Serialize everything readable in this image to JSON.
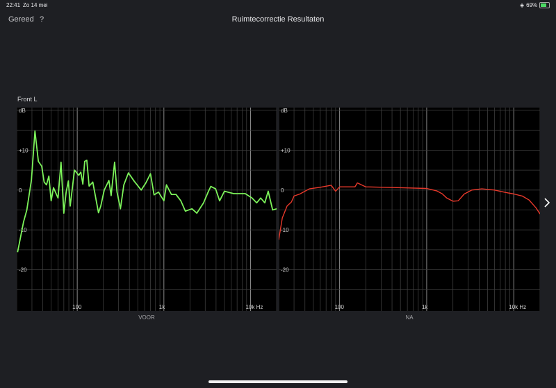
{
  "status_bar": {
    "time": "22:41",
    "date": "Zo 14 mei",
    "battery": "69%"
  },
  "nav": {
    "done_label": "Gereed",
    "help_label": "?",
    "title": "Ruimtecorrectie Resultaten"
  },
  "speaker_label": "Front L",
  "colors": {
    "before": "#7cf25a",
    "after": "#e8392b"
  },
  "chart_data": [
    {
      "type": "line",
      "title": "VOOR",
      "xlabel": "Hz",
      "ylabel": "dB",
      "xscale": "log",
      "xlim": [
        20,
        20000
      ],
      "ylim": [
        -30,
        20
      ],
      "xticks": [
        {
          "v": 100,
          "label": "100"
        },
        {
          "v": 1000,
          "label": "1k"
        },
        {
          "v": 10000,
          "label": "10k Hz"
        }
      ],
      "yticks": [
        {
          "v": 20,
          "label": "dB"
        },
        {
          "v": 10,
          "label": "+10"
        },
        {
          "v": 0,
          "label": "0"
        },
        {
          "v": -10,
          "label": "-10"
        },
        {
          "v": -20,
          "label": "-20"
        }
      ],
      "grid": true,
      "series": [
        {
          "name": "VOOR",
          "x": [
            20.5,
            24,
            26.2,
            29.6,
            32.5,
            35.6,
            38.9,
            41.5,
            44.2,
            47,
            50,
            53.2,
            60,
            65,
            70,
            74.5,
            79,
            83,
            93,
            104,
            110,
            116,
            122,
            129,
            137,
            151,
            165,
            176,
            187,
            205,
            232,
            246,
            270,
            288,
            315,
            345,
            390,
            455,
            548,
            620,
            700,
            770,
            865,
            1000,
            1070,
            1220,
            1380,
            1570,
            1770,
            2110,
            2400,
            2870,
            3270,
            3480,
            3950,
            4400,
            5000,
            6400,
            8700,
            10400,
            11800,
            13100,
            14600,
            16000,
            18000,
            20000
          ],
          "y": [
            -15.6,
            -8,
            -5,
            2.5,
            14.8,
            7.2,
            6,
            2,
            1.3,
            3.5,
            -2.7,
            0.6,
            -2,
            7,
            -5.8,
            -0.5,
            2.3,
            -4,
            5,
            3.7,
            4.5,
            1.5,
            7.2,
            7.5,
            1,
            2,
            -2.5,
            -5.7,
            -4,
            0,
            2.4,
            -1.4,
            7,
            -0.5,
            -4.7,
            1.3,
            4.3,
            2.2,
            0,
            1.8,
            4.1,
            -1.2,
            -0.5,
            -2.7,
            1.3,
            -1.1,
            -1.1,
            -2.7,
            -5.3,
            -4.7,
            -5.8,
            -3.2,
            -0.3,
            0.9,
            0.3,
            -2.7,
            -0.3,
            -0.9,
            -0.9,
            -2,
            -3.2,
            -2,
            -3.2,
            -0.3,
            -5,
            -4.7
          ]
        }
      ]
    },
    {
      "type": "line",
      "title": "NA",
      "xlabel": "Hz",
      "ylabel": "dB",
      "xscale": "log",
      "xlim": [
        20,
        20000
      ],
      "ylim": [
        -30,
        20
      ],
      "xticks": [
        {
          "v": 100,
          "label": "100"
        },
        {
          "v": 1000,
          "label": "1k"
        },
        {
          "v": 10000,
          "label": "10k Hz"
        }
      ],
      "yticks": [
        {
          "v": 20,
          "label": "dB"
        },
        {
          "v": 10,
          "label": "+10"
        },
        {
          "v": 0,
          "label": "0"
        },
        {
          "v": -10,
          "label": "-10"
        },
        {
          "v": -20,
          "label": "-20"
        }
      ],
      "grid": true,
      "series": [
        {
          "name": "NA",
          "x": [
            20,
            22,
            25,
            28,
            30,
            35,
            40,
            45,
            60,
            80,
            90,
            100,
            150,
            160,
            200,
            500,
            1000,
            1300,
            1500,
            1700,
            2000,
            2300,
            2700,
            3300,
            4300,
            6000,
            8000,
            10000,
            12500,
            15000,
            18000,
            20000
          ],
          "y": [
            -12.5,
            -7,
            -4,
            -3,
            -1.5,
            -1,
            -0.3,
            0.3,
            0.7,
            1.2,
            -0.3,
            0.8,
            0.8,
            1.8,
            0.8,
            0.6,
            0.4,
            -0.2,
            -0.9,
            -2,
            -2.8,
            -2.7,
            -1,
            0,
            0.3,
            0,
            -0.6,
            -1,
            -1.5,
            -2.5,
            -4.5,
            -6
          ]
        }
      ]
    }
  ]
}
